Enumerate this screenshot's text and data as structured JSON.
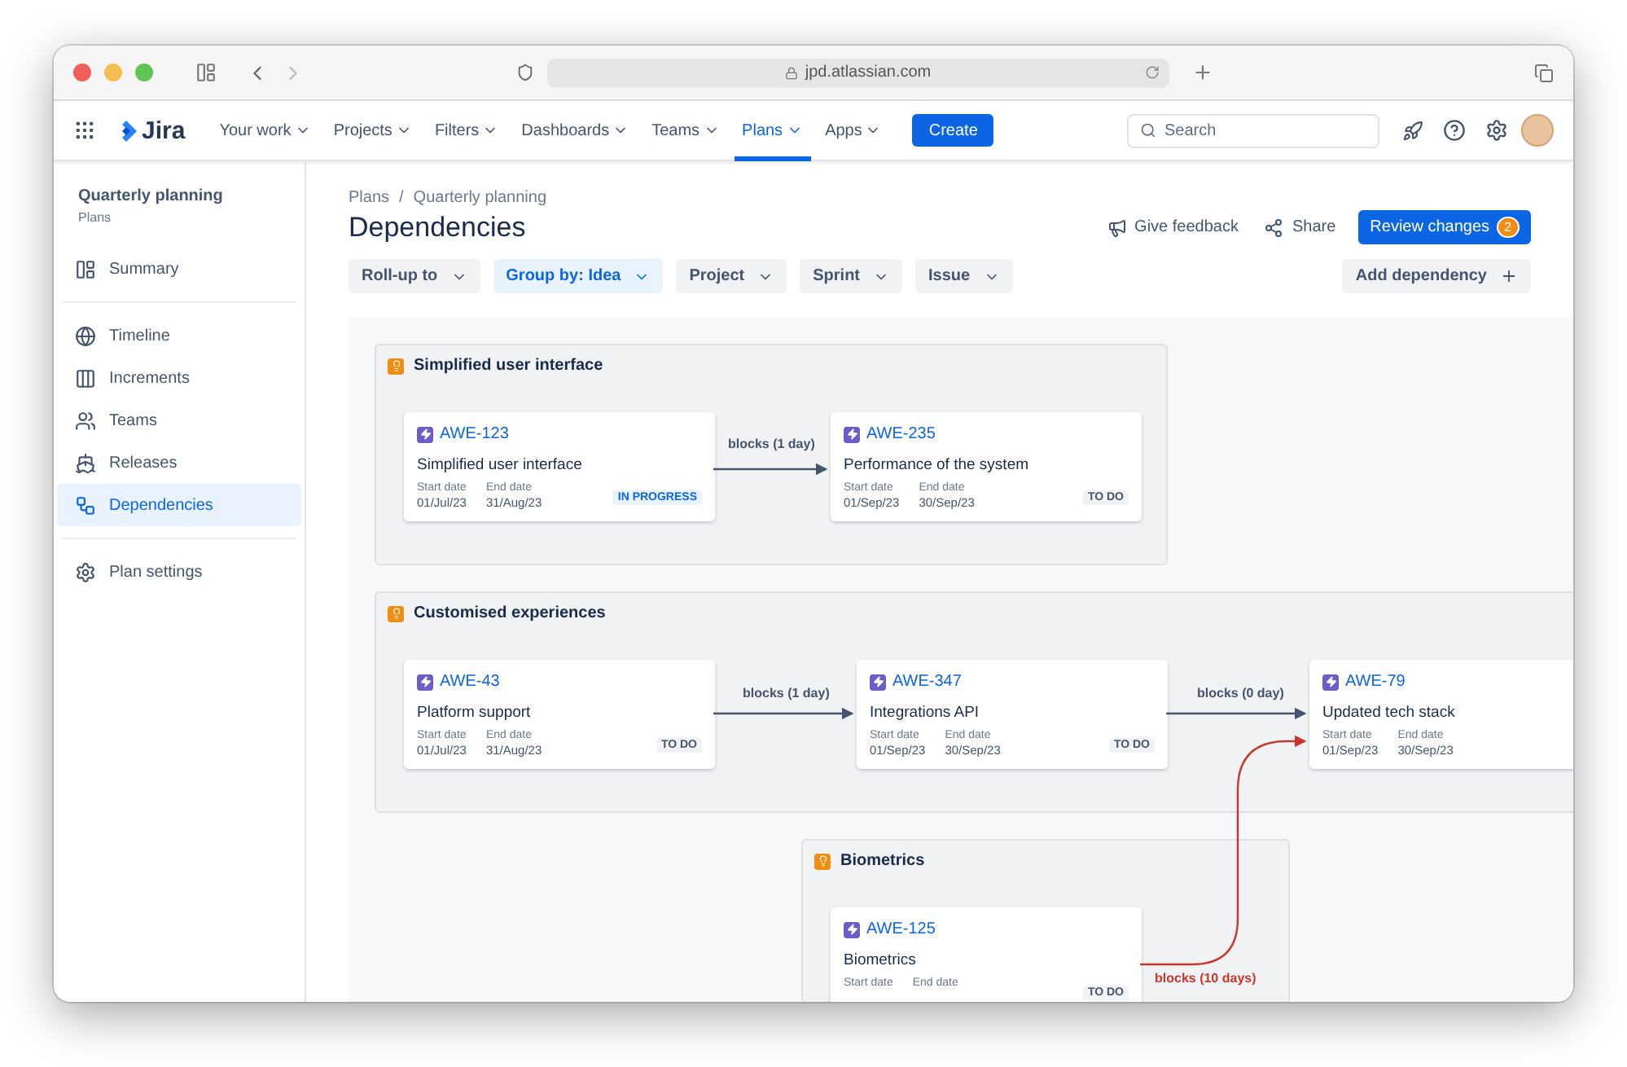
{
  "browser": {
    "url": "jpd.atlassian.com"
  },
  "nav": {
    "product": "Jira",
    "items": [
      {
        "label": "Your work",
        "selected": false
      },
      {
        "label": "Projects",
        "selected": false
      },
      {
        "label": "Filters",
        "selected": false
      },
      {
        "label": "Dashboards",
        "selected": false
      },
      {
        "label": "Teams",
        "selected": false
      },
      {
        "label": "Plans",
        "selected": true
      },
      {
        "label": "Apps",
        "selected": false
      }
    ],
    "create": "Create",
    "search": {
      "placeholder": "Search"
    }
  },
  "sidebar": {
    "title": "Quarterly planning",
    "subtitle": "Plans",
    "sections": [
      [
        {
          "label": "Summary",
          "kind": "summary",
          "selected": false
        }
      ],
      [
        {
          "label": "Timeline",
          "kind": "timeline",
          "selected": false
        },
        {
          "label": "Increments",
          "kind": "increments",
          "selected": false
        },
        {
          "label": "Teams",
          "kind": "teams",
          "selected": false
        },
        {
          "label": "Releases",
          "kind": "releases",
          "selected": false
        },
        {
          "label": "Dependencies",
          "kind": "dependencies",
          "selected": true
        }
      ],
      [
        {
          "label": "Plan settings",
          "kind": "settings",
          "selected": false
        }
      ]
    ]
  },
  "breadcrumbs": [
    "Plans",
    "Quarterly planning"
  ],
  "breadcrumb_separator": "/",
  "title": "Dependencies",
  "actions": {
    "feedback": "Give feedback",
    "share": "Share",
    "review": "Review changes",
    "review_count": "2"
  },
  "filters": [
    {
      "label": "Roll-up to",
      "selected": false
    },
    {
      "label": "Group by: Idea",
      "selected": true
    },
    {
      "label": "Project",
      "selected": false
    },
    {
      "label": "Sprint",
      "selected": false
    },
    {
      "label": "Issue",
      "selected": false
    }
  ],
  "add_dependency": "Add dependency",
  "groups": [
    {
      "title": "Simplified user interface",
      "cards": [
        {
          "key": "AWE-123",
          "summary": "Simplified user interface",
          "start_label": "Start date",
          "start": "01/Jul/23",
          "end_label": "End date",
          "end": "31/Aug/23",
          "status": "IN PROGRESS",
          "kind": "in_progress"
        },
        {
          "key": "AWE-235",
          "summary": "Performance of the system",
          "start_label": "Start date",
          "start": "01/Sep/23",
          "end_label": "End date",
          "end": "30/Sep/23",
          "status": "TO DO",
          "kind": "todo"
        }
      ]
    },
    {
      "title": "Customised experiences",
      "cards": [
        {
          "key": "AWE-43",
          "summary": "Platform support",
          "start_label": "Start date",
          "start": "01/Jul/23",
          "end_label": "End date",
          "end": "31/Aug/23",
          "status": "TO DO",
          "kind": "todo"
        },
        {
          "key": "AWE-347",
          "summary": "Integrations API",
          "start_label": "Start date",
          "start": "01/Sep/23",
          "end_label": "End date",
          "end": "30/Sep/23",
          "status": "TO DO",
          "kind": "todo"
        },
        {
          "key": "AWE-79",
          "summary": "Updated tech stack",
          "start_label": "Start date",
          "start": "01/Sep/23",
          "end_label": "End date",
          "end": "30/Sep/23"
        }
      ]
    },
    {
      "title": "Biometrics",
      "cards": [
        {
          "key": "AWE-125",
          "summary": "Biometrics",
          "start_label": "Start date",
          "end_label": "End date",
          "status": "TO DO",
          "kind": "todo"
        }
      ]
    }
  ],
  "dependencies": [
    {
      "label": "blocks (1 day)",
      "kind": "ok"
    },
    {
      "label": "blocks (1 day)",
      "kind": "ok"
    },
    {
      "label": "blocks (0 day)",
      "kind": "ok"
    },
    {
      "label": "blocks (10 days)",
      "kind": "overdue"
    }
  ]
}
